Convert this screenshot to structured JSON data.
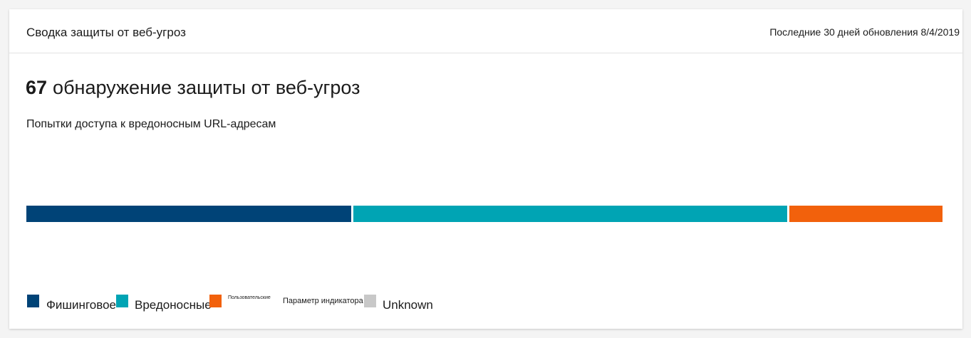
{
  "card": {
    "title": "Сводка защиты от веб-угроз",
    "meta": "Последние 30 дней обновления 8/4/2019"
  },
  "headline": {
    "count": "67",
    "text": "обнаружение защиты от веб-угроз"
  },
  "subtitle": "Попытки доступа к вредоносным URL-адресам",
  "bar": {
    "segments": [
      {
        "category": "phishing",
        "fraction": 0.357,
        "color": "#004377"
      },
      {
        "category": "malicious",
        "fraction": 0.476,
        "color": "#00a4b4"
      },
      {
        "category": "custom",
        "fraction": 0.167,
        "color": "#f2610c"
      }
    ]
  },
  "legend": {
    "phishing": {
      "label": "Фишинговое",
      "color": "#004377"
    },
    "malicious": {
      "label": "Вредоносные",
      "color": "#00a4b4"
    },
    "custom": {
      "label": "Пользовательские",
      "color": "#f2610c"
    },
    "indicator": {
      "label": "Параметр индикатора"
    },
    "unknown": {
      "label": "Unknown",
      "color": "#c8c8c8"
    }
  }
}
